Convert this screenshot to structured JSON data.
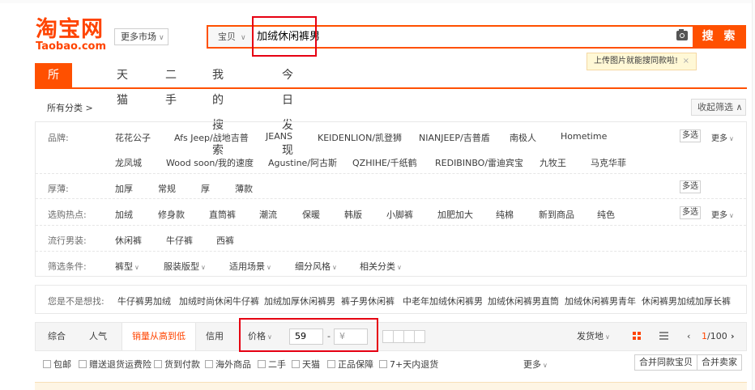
{
  "header": {
    "logo_cn": "淘宝网",
    "logo_en": "Taobao.com",
    "market_label": "更多市场",
    "search_type": "宝贝",
    "search_query": "加绒休闲裤男",
    "search_button": "搜 索",
    "tip_text": "上传图片就能搜同款啦!",
    "tip_close": "×"
  },
  "nav": {
    "tabs": [
      "所有宝贝",
      "天猫",
      "二手",
      "我的搜索",
      "今日发现"
    ]
  },
  "category": {
    "all_label": "所有分类 >",
    "fold_label": "收起筛选 ∧"
  },
  "filters": {
    "brand_label": "品牌:",
    "brands_row1": [
      "花花公子",
      "Afs Jeep/战地吉普",
      "JEANS",
      "KEIDENLION/凯登狮",
      "NIANJEEP/吉普盾",
      "南极人",
      "Hometime"
    ],
    "brands_row2": [
      "龙凤城",
      "Wood soon/我的速度",
      "Agustine/阿古斯",
      "QZHIHE/千纸鹤",
      "REDIBINBO/雷迪宾宝",
      "九牧王",
      "马克华菲"
    ],
    "thickness_label": "厚薄:",
    "thickness": [
      "加厚",
      "常规",
      "厚",
      "薄款"
    ],
    "hot_label": "选购热点:",
    "hot": [
      "加绒",
      "修身款",
      "直筒裤",
      "潮流",
      "保暖",
      "韩版",
      "小脚裤",
      "加肥加大",
      "纯棉",
      "新到商品",
      "纯色"
    ],
    "popular_label": "流行男装:",
    "popular": [
      "休闲裤",
      "牛仔裤",
      "西裤"
    ],
    "condition_label": "筛选条件:",
    "conditions": [
      "裤型",
      "服装版型",
      "适用场景",
      "细分风格",
      "相关分类"
    ],
    "multi": "多选",
    "more": "更多"
  },
  "suggest": {
    "label": "您是不是想找:",
    "items": [
      "牛仔裤男加绒",
      "加绒时尚休闲牛仔裤",
      "加绒加厚休闲裤男",
      "裤子男休闲裤",
      "中老年加绒休闲裤男",
      "加绒休闲裤男直筒",
      "加绒休闲裤男青年",
      "休闲裤男加绒加厚长裤"
    ]
  },
  "sortbar": {
    "items": [
      "综合",
      "人气",
      "销量从高到低",
      "信用"
    ],
    "price_label": "价格",
    "price_min": "59",
    "price_max_placeholder": "¥",
    "price_dash": "-",
    "ship_label": "发货地",
    "page_current": "1",
    "page_total": "/100"
  },
  "checkbar": {
    "items": [
      "包邮",
      "赠送退货运费险",
      "货到付款",
      "海外商品",
      "二手",
      "天猫",
      "正品保障",
      "7+天内退货"
    ],
    "more": "更多",
    "merge_same": "合并同款宝贝",
    "merge_seller": "合并卖家"
  },
  "colors": {
    "brand": "#ff5000",
    "highlight": "#e60012"
  }
}
